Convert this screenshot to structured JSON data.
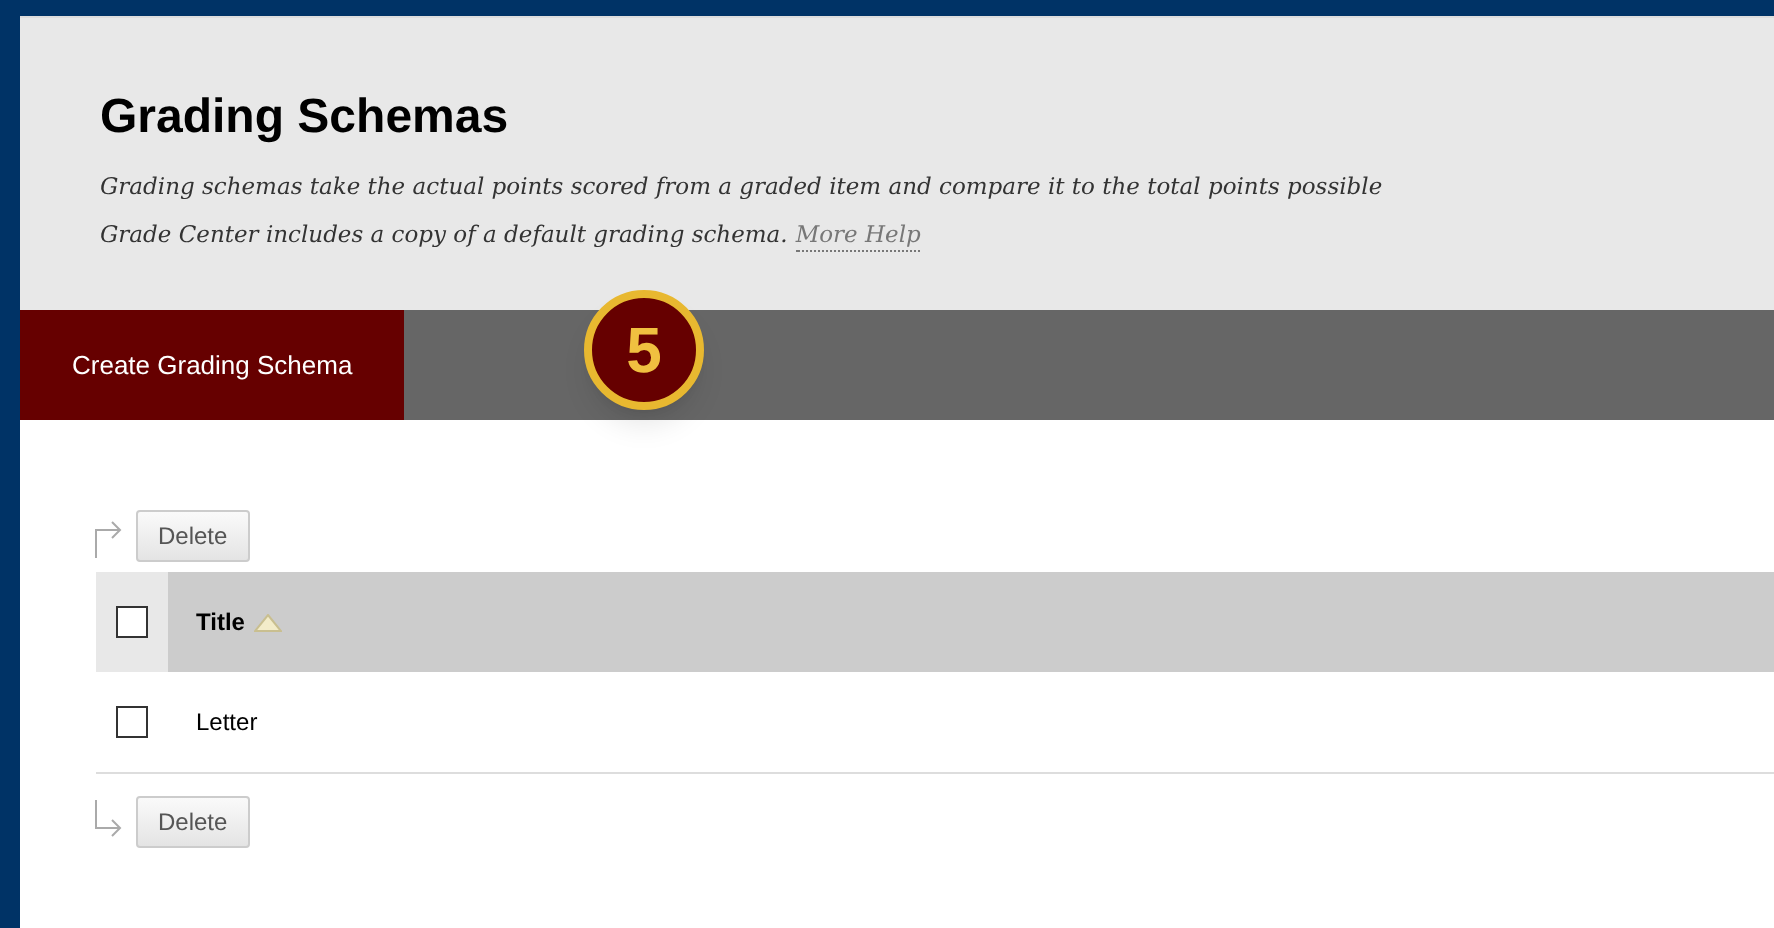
{
  "page": {
    "title": "Grading Schemas",
    "description_lines": [
      "Grading schemas take the actual points scored from a graded item and compare it to the total points possible",
      "Grade Center includes a copy of a default grading schema."
    ],
    "help_link": "More Help"
  },
  "action_bar": {
    "button": "Create Grading Schema",
    "step_badge": "5"
  },
  "top_actions": [
    "Delete"
  ],
  "table": {
    "columns": [
      {
        "label": "Title",
        "sorted": true,
        "checked": false
      }
    ],
    "rows": [
      {
        "title": "Letter",
        "checked": false
      }
    ]
  },
  "bottom_actions": [
    "Delete"
  ]
}
